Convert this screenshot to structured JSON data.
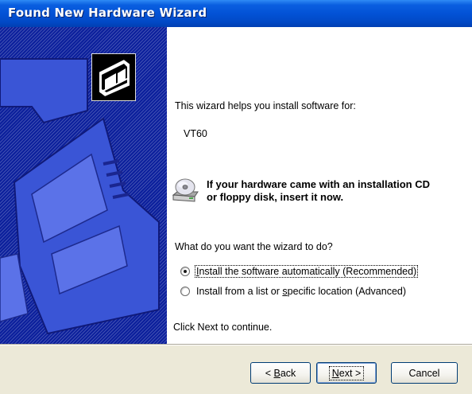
{
  "window": {
    "title": "Found New Hardware Wizard"
  },
  "content": {
    "intro": "This wizard helps you install software for:",
    "device_name": "VT60",
    "cd_line1": "If your hardware came with an installation CD",
    "cd_line2": "or floppy disk, insert it now.",
    "question": "What do you want the wizard to do?",
    "options": [
      {
        "pre": "",
        "mnemonic": "I",
        "post": "nstall the software automatically (Recommended)",
        "selected": true
      },
      {
        "pre": "Install from a list or ",
        "mnemonic": "s",
        "post": "pecific location (Advanced)",
        "selected": false
      }
    ],
    "footer": "Click Next to continue."
  },
  "buttons": {
    "back": {
      "arrow": "<",
      "mnemonic": "B",
      "rest": "ack"
    },
    "next": {
      "mnemonic": "N",
      "rest": "ext",
      "arrow": ">"
    },
    "cancel": "Cancel"
  },
  "icons": {
    "sidebar": "hardware-wizard-icon",
    "cd": "cd-drive-icon"
  },
  "colors": {
    "titlebar": "#0352d6",
    "sidebar": "#0b1f9c",
    "button_border": "#003c74"
  }
}
